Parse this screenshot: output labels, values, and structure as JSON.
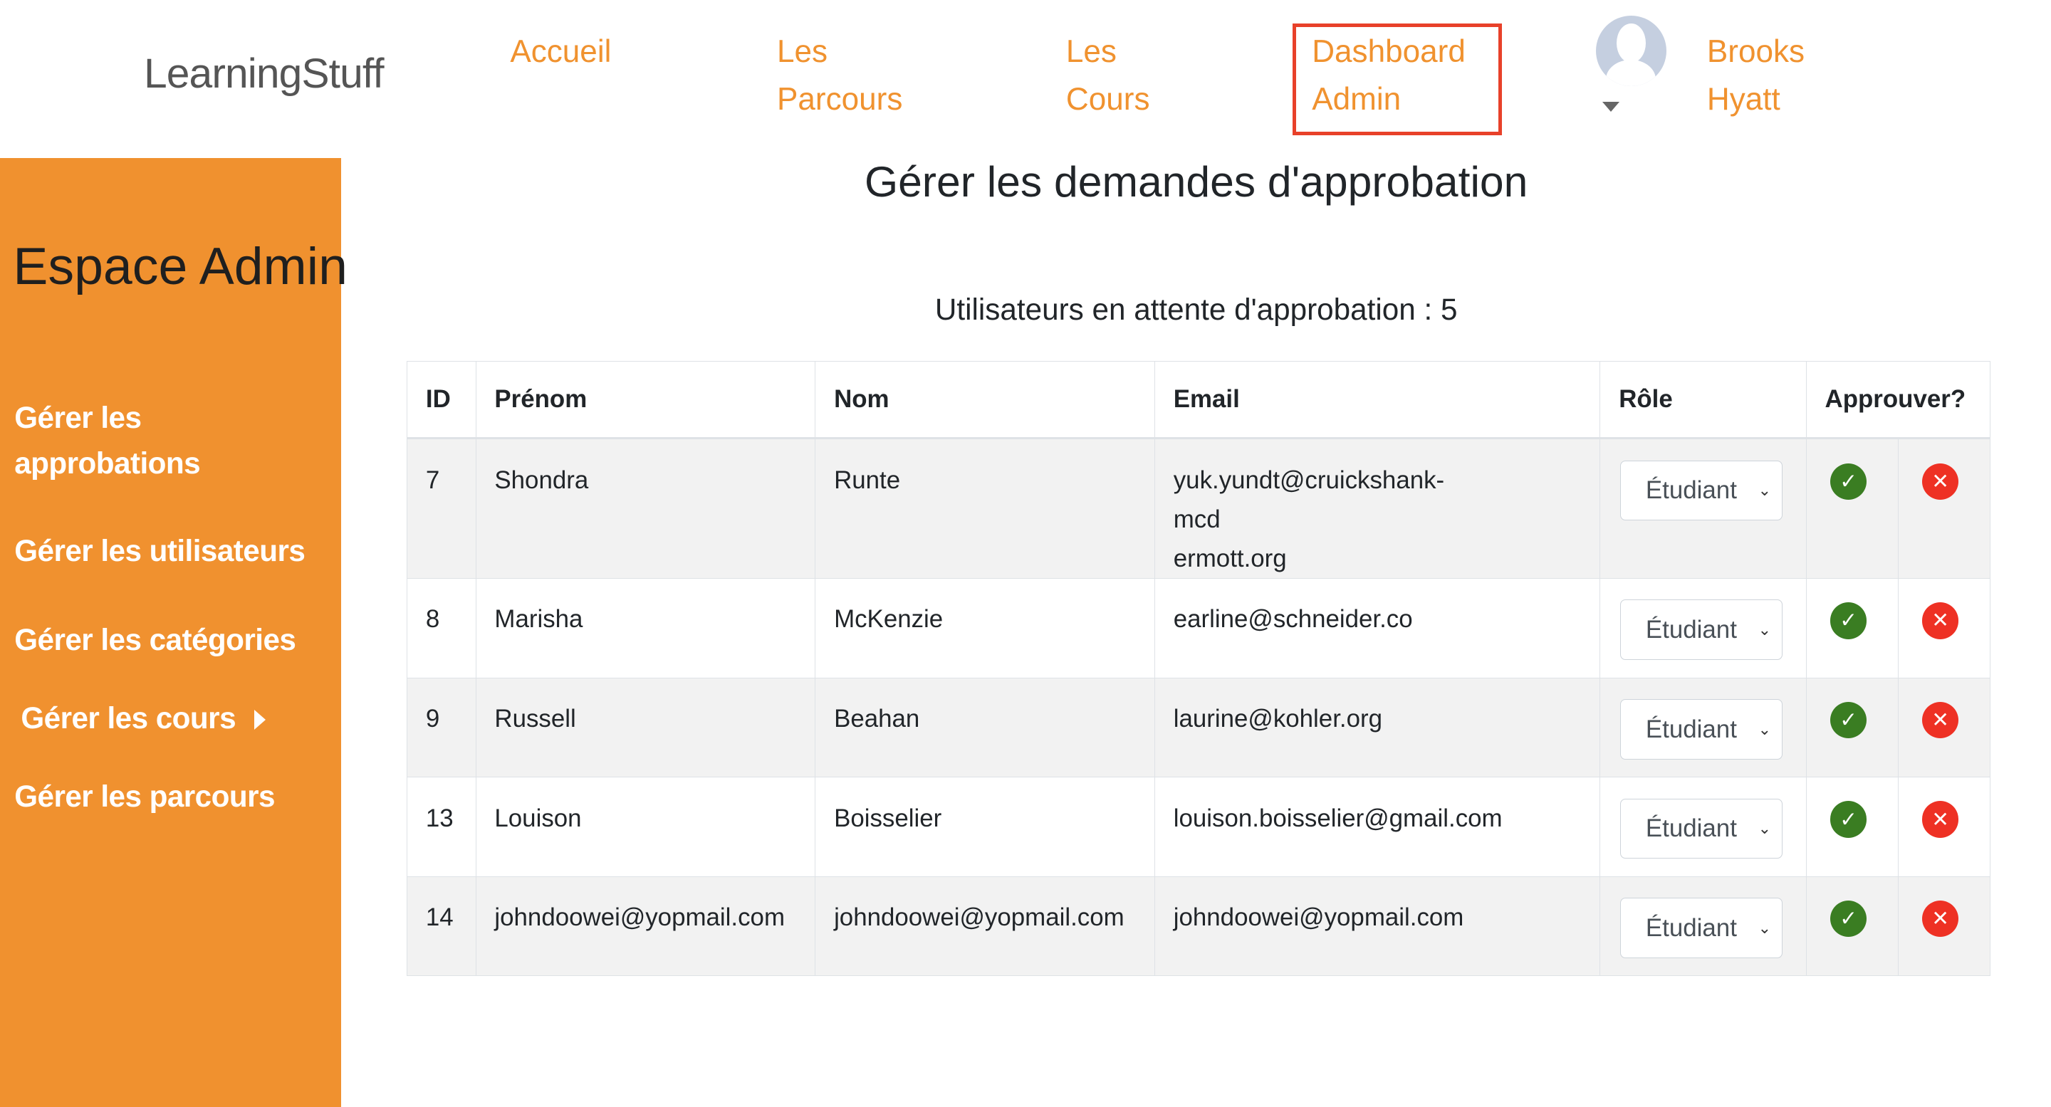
{
  "header": {
    "logo": "LearningStuff",
    "nav": [
      "Accueil",
      "Les\nParcours",
      "Les\nCours",
      "Dashboard\nAdmin"
    ],
    "nav_lines": [
      [
        "Accueil"
      ],
      [
        "Les",
        "Parcours"
      ],
      [
        "Les",
        "Cours"
      ],
      [
        "Dashboard",
        "Admin"
      ]
    ],
    "user": [
      "Brooks",
      "Hyatt"
    ],
    "active": "Dashboard Admin"
  },
  "sidebar": {
    "title": "Espace Admin",
    "items": [
      [
        "Gérer les",
        "approbations"
      ],
      "Gérer les utilisateurs",
      "Gérer les catégories",
      "Gérer les cours",
      "Gérer les parcours"
    ]
  },
  "main": {
    "title": "Gérer les demandes d'approbation",
    "pending": "Utilisateurs en attente d'approbation : 5",
    "columns": [
      "ID",
      "Prénom",
      "Nom",
      "Email",
      "Rôle",
      "Approuver?"
    ],
    "rows": [
      {
        "id": "7",
        "prenom": "Shondra",
        "nom": "Runte",
        "email": "yuk.yundt@cruickshank-mcdermott.org",
        "role": "Étudiant"
      },
      {
        "id": "8",
        "prenom": "Marisha",
        "nom": "McKenzie",
        "email": "earline@schneider.co",
        "role": "Étudiant"
      },
      {
        "id": "9",
        "prenom": "Russell",
        "nom": "Beahan",
        "email": "laurine@kohler.org",
        "role": "Étudiant"
      },
      {
        "id": "13",
        "prenom": "Louison",
        "nom": "Boisselier",
        "email": "louison.boisselier@gmail.com",
        "role": "Étudiant"
      },
      {
        "id": "14",
        "prenom": "johndoowei@yopmail.com",
        "nom": "johndoowei@yopmail.com",
        "email": "johndoowei@yopmail.com",
        "role": "Étudiant"
      }
    ]
  },
  "colors": {
    "accent": "#f0922f",
    "highlight": "#e8412a",
    "approve": "#3a7d22",
    "reject": "#ee3124"
  }
}
